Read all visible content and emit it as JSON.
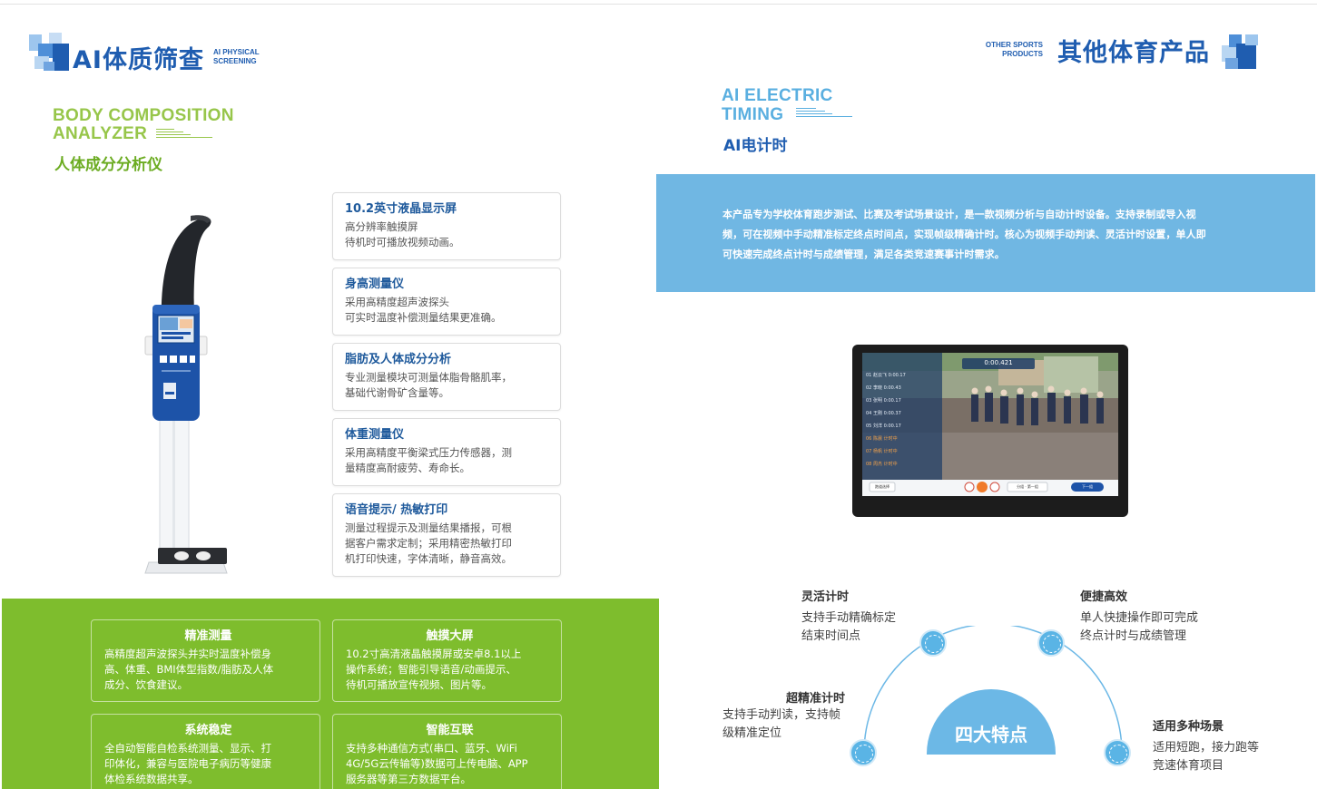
{
  "left_header": {
    "title": "AI体质筛查",
    "subtitle_line1": "AI PHYSICAL",
    "subtitle_line2": "SCREENING"
  },
  "right_header": {
    "title": "其他体育产品",
    "subtitle_line1": "OTHER SPORTS",
    "subtitle_line2": "PRODUCTS"
  },
  "body_section": {
    "en_line1": "BODY COMPOSITION",
    "en_line2": "ANALYZER",
    "cn_title": "人体成分分析仪"
  },
  "timing_section": {
    "en_line1": "AI ELECTRIC",
    "en_line2": "TIMING",
    "cn_title": "AI电计时"
  },
  "feature_cards": [
    {
      "title": "10.2英寸液晶显示屏",
      "lines": [
        "高分辨率触摸屏",
        "待机时可播放视频动画。"
      ]
    },
    {
      "title": "身高测量仪",
      "lines": [
        "采用高精度超声波探头",
        "可实时温度补偿测量结果更准确。"
      ]
    },
    {
      "title": "脂肪及人体成分分析",
      "lines": [
        "专业测量模块可测量体脂骨骼肌率，",
        "基础代谢骨矿含量等。"
      ]
    },
    {
      "title": "体重测量仪",
      "lines": [
        "采用高精度平衡梁式压力传感器，测",
        "量精度高耐疲劳、寿命长。"
      ]
    },
    {
      "title": "语音提示/ 热敏打印",
      "lines": [
        "测量过程提示及测量结果播报，可根",
        "据客户需求定制；采用精密热敏打印",
        "机打印快速，字体清晰，静音高效。"
      ]
    }
  ],
  "green_cards": [
    {
      "title": "精准测量",
      "lines": [
        "高精度超声波探头并实时温度补偿身",
        "高、体重、BMI体型指数/脂肪及人体",
        "成分、饮食建议。"
      ]
    },
    {
      "title": "触摸大屏",
      "lines": [
        "10.2寸高清液晶触摸屏或安卓8.1以上",
        "操作系统；智能引导语音/动画提示、",
        "待机可播放宣传视频、图片等。"
      ]
    },
    {
      "title": "系统稳定",
      "lines": [
        "全自动智能自检系统测量、显示、打",
        "印体化，兼容与医院电子病历等健康",
        "体检系统数据共享。"
      ]
    },
    {
      "title": "智能互联",
      "lines": [
        "支持多种通信方式(串口、蓝牙、WiFi",
        "4G/5G云传输等)数据可上传电脑、APP",
        "服务器等第三方数据平台。"
      ]
    }
  ],
  "timing_description": [
    "本产品专为学校体育跑步测试、比赛及考试场景设计，是一款视频分析与自动计时设备。支持录制或导入视",
    "频，可在视频中手动精准标定终点时间点，实现帧级精确计时。核心为视频手动判读、灵活计时设置，单人即",
    "可快速完成终点计时与成绩管理，满足各类竞速赛事计时需求。"
  ],
  "tablet_screen": {
    "timer": "0:00.421",
    "rows": [
      {
        "no": "01",
        "name": "赵云飞",
        "time": "0:00.17"
      },
      {
        "no": "02",
        "name": "李晓",
        "time": "0:00.43"
      },
      {
        "no": "03",
        "name": "张明",
        "time": "0:00.17"
      },
      {
        "no": "04",
        "name": "王刚",
        "time": "0:00.37"
      },
      {
        "no": "05",
        "name": "刘洋",
        "time": "0:00.17"
      },
      {
        "no": "06",
        "name": "陈晨",
        "time": "计时中"
      },
      {
        "no": "07",
        "name": "杨帆",
        "time": "计时中"
      },
      {
        "no": "08",
        "name": "周杰",
        "time": "计时中"
      }
    ],
    "btn_left": "跑道选择",
    "btn_mid": "分组 · 第一组",
    "btn_right": "下一组"
  },
  "features": {
    "center_label": "四大特点",
    "items": [
      {
        "title": "灵活计时",
        "lines": [
          "支持手动精确标定",
          "结束时间点"
        ]
      },
      {
        "title": "便捷高效",
        "lines": [
          "单人快捷操作即可完成",
          "终点计时与成绩管理"
        ]
      },
      {
        "title": "超精准计时",
        "lines": [
          "支持手动判读，支持帧",
          "级精准定位"
        ]
      },
      {
        "title": "适用多种场景",
        "lines": [
          "适用短跑，接力跑等",
          "竞速体育项目"
        ]
      }
    ]
  },
  "colors": {
    "brand_blue": "#1f5db0",
    "light_blue": "#70b7e3",
    "green": "#7ebd2d",
    "light_green": "#97c64a"
  }
}
